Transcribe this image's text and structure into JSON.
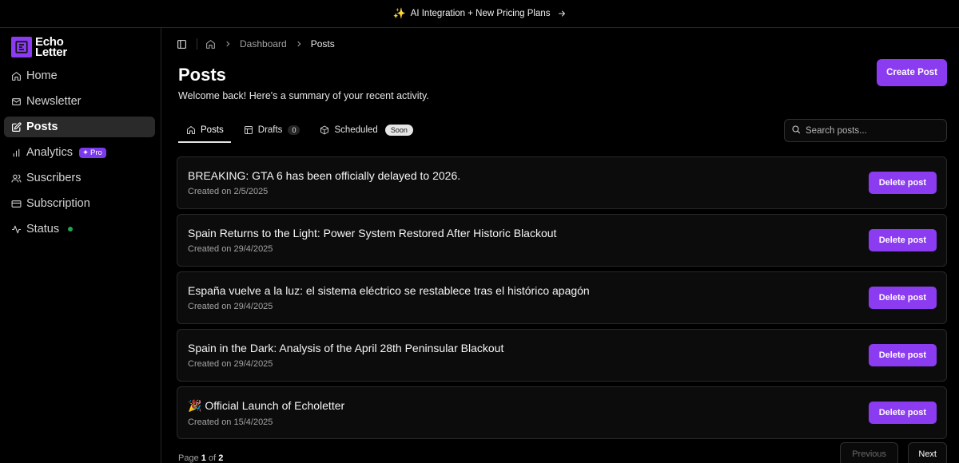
{
  "banner": {
    "icon": "sparkles-icon",
    "text": "AI Integration + New Pricing Plans"
  },
  "logo": {
    "line1": "Echo",
    "line2": "Letter",
    "accent": "#8b3bf0"
  },
  "sidebar": {
    "items": [
      {
        "label": "Home",
        "icon": "home-icon"
      },
      {
        "label": "Newsletter",
        "icon": "mail-icon"
      },
      {
        "label": "Posts",
        "icon": "edit-icon",
        "active": true
      },
      {
        "label": "Analytics",
        "icon": "bar-chart-icon",
        "badge": "Pro"
      },
      {
        "label": "Suscribers",
        "icon": "users-icon"
      },
      {
        "label": "Subscription",
        "icon": "credit-card-icon"
      },
      {
        "label": "Status",
        "icon": "activity-icon",
        "status_color": "#22a64a"
      }
    ]
  },
  "breadcrumb": {
    "items": [
      "Dashboard",
      "Posts"
    ]
  },
  "header": {
    "title": "Posts",
    "subtitle": "Welcome back! Here's a summary of your recent activity.",
    "create_label": "Create Post"
  },
  "tabs": [
    {
      "label": "Posts",
      "active": true
    },
    {
      "label": "Drafts",
      "count": "0"
    },
    {
      "label": "Scheduled",
      "badge": "Soon"
    }
  ],
  "search": {
    "placeholder": "Search posts..."
  },
  "posts": [
    {
      "title": "BREAKING: GTA 6 has been officially delayed to 2026.",
      "date": "Created on 2/5/2025",
      "action": "Delete post"
    },
    {
      "title": "Spain Returns to the Light: Power System Restored After Historic Blackout",
      "date": "Created on 29/4/2025",
      "action": "Delete post"
    },
    {
      "title": "España vuelve a la luz: el sistema eléctrico se restablece tras el histórico apagón",
      "date": "Created on 29/4/2025",
      "action": "Delete post"
    },
    {
      "title": "Spain in the Dark: Analysis of the April 28th Peninsular Blackout",
      "date": "Created on 29/4/2025",
      "action": "Delete post"
    },
    {
      "title": "🎉 Official Launch of Echoletter",
      "date": "Created on 15/4/2025",
      "action": "Delete post"
    }
  ],
  "pagination": {
    "prefix": "Page",
    "current": "1",
    "of": "of",
    "total": "2",
    "prev_label": "Previous",
    "next_label": "Next"
  }
}
